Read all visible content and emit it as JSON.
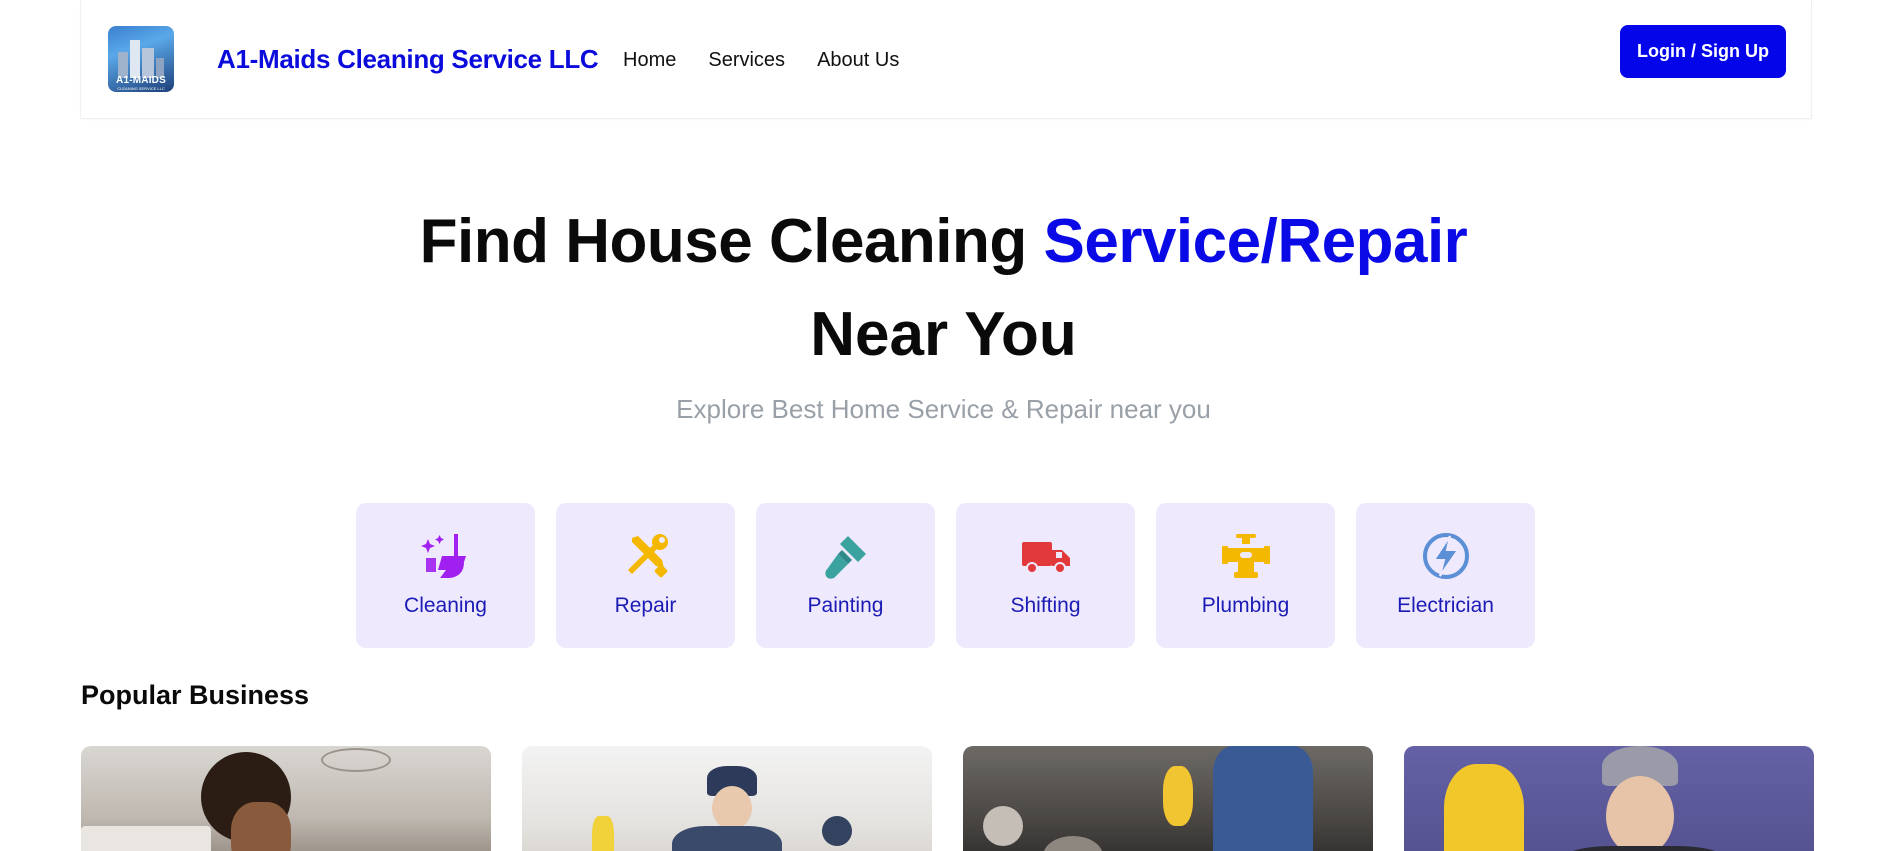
{
  "brand": {
    "name": "A1-Maids Cleaning Service LLC",
    "logo_text": "A1-MAIDS",
    "logo_subtext": "CLEANING SERVICE LLC"
  },
  "nav": {
    "links": [
      "Home",
      "Services",
      "About Us"
    ],
    "login_label": "Login / Sign Up"
  },
  "hero": {
    "title_part1": "Find House Cleaning ",
    "title_accent": "Service/Repair",
    "title_line2": "Near You",
    "subtitle": "Explore Best Home Service & Repair near you"
  },
  "categories": [
    {
      "label": "Cleaning",
      "icon": "cleaning-icon",
      "color": "#a020f0"
    },
    {
      "label": "Repair",
      "icon": "tools-icon",
      "color": "#f5b800"
    },
    {
      "label": "Painting",
      "icon": "paintbrush-icon",
      "color": "#3aa3a0"
    },
    {
      "label": "Shifting",
      "icon": "truck-icon",
      "color": "#e23a3a"
    },
    {
      "label": "Plumbing",
      "icon": "pipe-icon",
      "color": "#f5b800"
    },
    {
      "label": "Electrician",
      "icon": "lightning-icon",
      "color": "#5b8fd6"
    }
  ],
  "popular": {
    "title": "Popular Business"
  },
  "colors": {
    "accent": "#0a0ae6",
    "button": "#0505ea",
    "category_bg": "#efe9fd",
    "category_text": "#1b1bb5"
  }
}
